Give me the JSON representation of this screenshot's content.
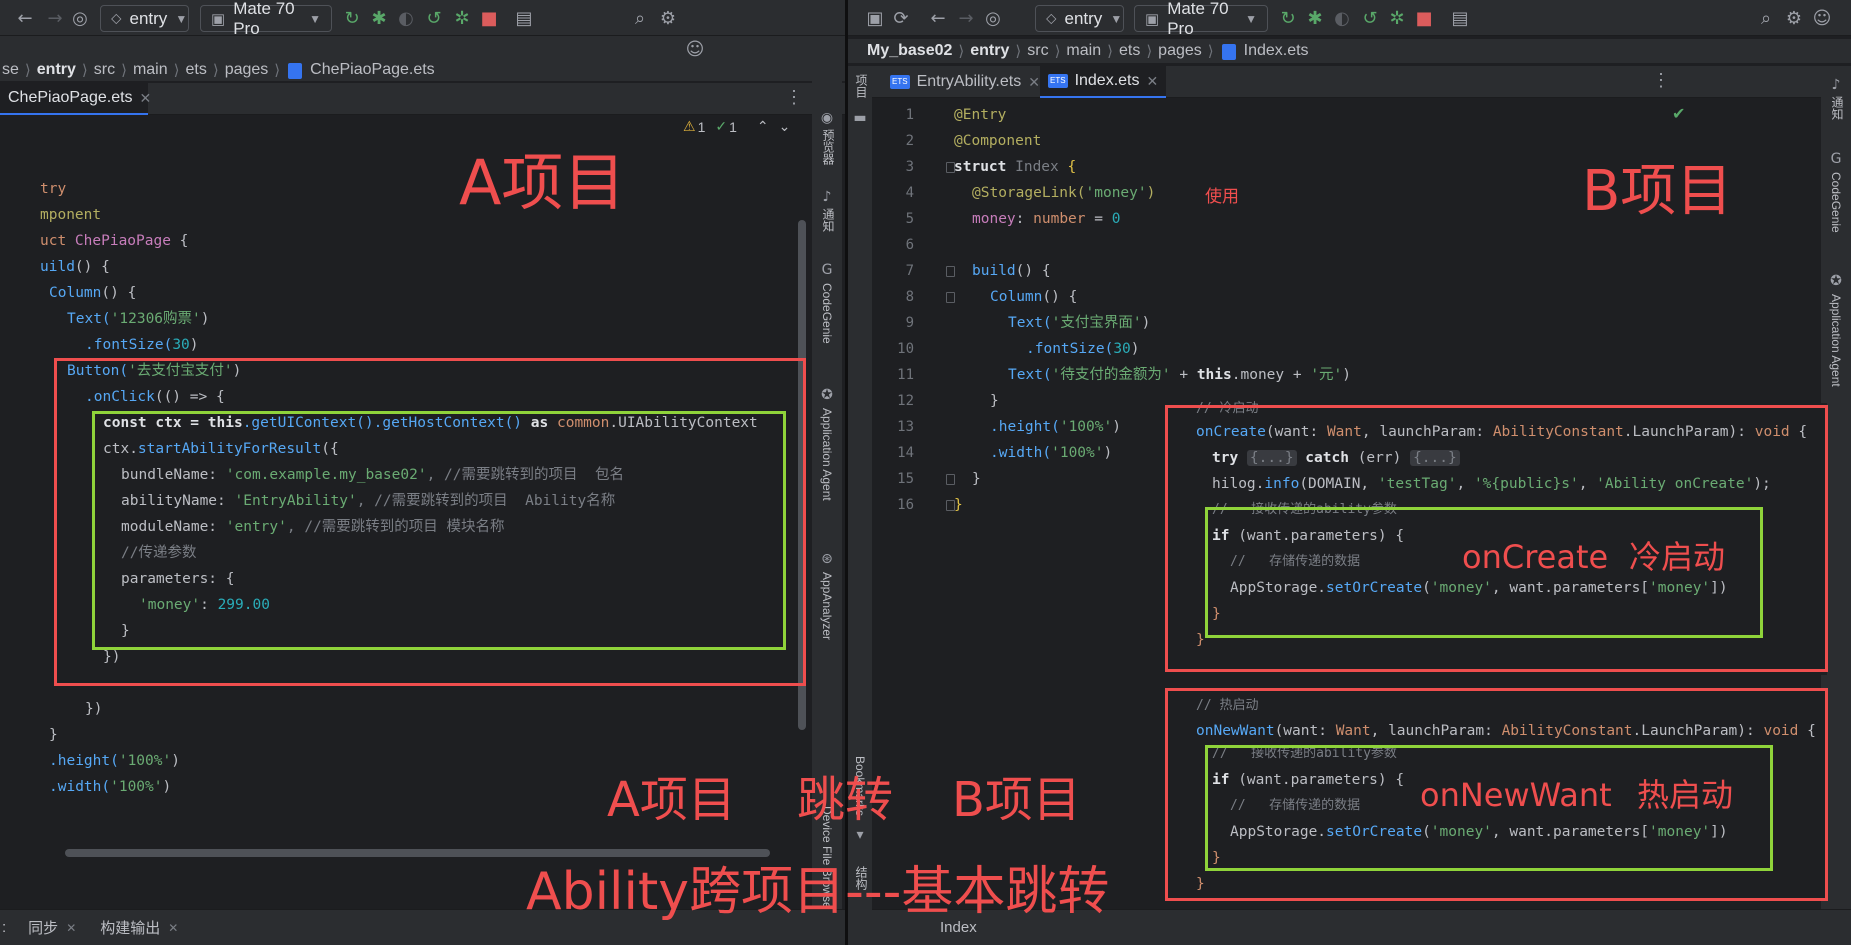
{
  "left": {
    "toolbar": {
      "module": "entry",
      "device": "Mate 70 Pro"
    },
    "breadcrumb": [
      "se",
      "entry",
      "src",
      "main",
      "ets",
      "pages",
      "ChePiaoPage.ets"
    ],
    "tab": "ChePiaoPage.ets",
    "inspections": {
      "warnings": "1",
      "weak": "1"
    },
    "side_labels": [
      "预览器",
      "通知",
      "CodeGenie",
      "Application Agent",
      "AppAnalyzer",
      "Device File Browser"
    ],
    "code_plain": {
      "l1": "try",
      "l2": "mponent",
      "l3_a": "uct ",
      "l3_b": "ChePiaoPage",
      "l3_c": " {",
      "l4_a": "uild",
      "l4_b": "() {",
      "l5_a": "Column",
      "l5_b": "() {",
      "l6_a": "Text(",
      "l6_b": "'12306购票'",
      "l6_c": ")",
      "l7_a": ".fontSize(",
      "l7_b": "30",
      "l7_c": ")",
      "l8_a": "Button(",
      "l8_b": "'去支付宝支付'",
      "l8_c": ")",
      "l9_a": ".onClick",
      "l9_b": "(() => {",
      "l10_a": "const ctx = ",
      "l10_b": "this",
      "l10_c": ".getUIContext().getHostContext() ",
      "l10_d": "as",
      "l10_e": " common",
      "l10_f": ".UIAbilityContext",
      "l11_a": "ctx.",
      "l11_b": "startAbilityForResult",
      "l11_c": "({",
      "l12_a": "bundleName: ",
      "l12_b": "'com.example.my_base02'",
      "l12_c": ", //需要跳转到的项目  包名",
      "l13_a": "abilityName: ",
      "l13_b": "'EntryAbility'",
      "l13_c": ", //需要跳转到的项目  Ability名称",
      "l14_a": "moduleName: ",
      "l14_b": "'entry'",
      "l14_c": ", //需要跳转到的项目 模块名称",
      "l15": "//传递参数",
      "l16": "parameters: {",
      "l17_a": "'money'",
      "l17_b": ": ",
      "l17_c": "299.00",
      "l18": "}",
      "l19": "})",
      "l20": "})",
      "l21": "}",
      "l22_a": ".height(",
      "l22_b": "'100%'",
      "l22_c": ")",
      "l23_a": ".width(",
      "l23_b": "'100%'",
      "l23_c": ")"
    },
    "status_tabs": [
      ":",
      "同步",
      "构建输出"
    ]
  },
  "right": {
    "toolbar": {
      "module": "entry",
      "device": "Mate 70 Pro"
    },
    "breadcrumb": [
      "My_base02",
      "entry",
      "src",
      "main",
      "ets",
      "pages",
      "Index.ets"
    ],
    "tabs": [
      "EntryAbility.ets",
      "Index.ets"
    ],
    "project_label": "项目",
    "side_labels": [
      "通知",
      "CodeGenie",
      "Application Agent"
    ],
    "bottom_labels": [
      "Bookmarks",
      "结构"
    ],
    "status_text": "Index",
    "line_numbers": [
      "1",
      "2",
      "3",
      "4",
      "5",
      "6",
      "7",
      "8",
      "9",
      "10",
      "11",
      "12",
      "13",
      "14",
      "15",
      "16"
    ],
    "code": {
      "l1": "@Entry",
      "l2": "@Component",
      "l3_a": "struct",
      "l3_b": " Index ",
      "l3_c": "{",
      "l4_a": "@StorageLink(",
      "l4_b": "'money'",
      "l4_c": ")",
      "l5_a": "money",
      "l5_b": ": ",
      "l5_c": "number",
      "l5_d": " = ",
      "l5_e": "0",
      "l7_a": "build",
      "l7_b": "() {",
      "l8_a": "Column",
      "l8_b": "() {",
      "l9_a": "Text(",
      "l9_b": "'支付宝界面'",
      "l9_c": ")",
      "l10_a": ".fontSize(",
      "l10_b": "30",
      "l10_c": ")",
      "l11_a": "Text(",
      "l11_b": "'待支付的金额为'",
      "l11_c": " + ",
      "l11_d": "this",
      "l11_e": ".money + ",
      "l11_f": "'元'",
      "l11_g": ")",
      "l12": "}",
      "l13_a": ".height(",
      "l13_b": "'100%'",
      "l13_c": ")",
      "l14_a": ".width(",
      "l14_b": "'100%'",
      "l14_c": ")",
      "l15": "}",
      "l16": "}"
    },
    "overlay1": {
      "comment": "// 冷启动",
      "sig_a": "onCreate",
      "sig_b": "(want: ",
      "sig_c": "Want",
      "sig_d": ", launchParam: ",
      "sig_e": "AbilityConstant",
      "sig_f": ".LaunchParam): ",
      "sig_g": "void",
      "sig_h": " {",
      "try_a": "try ",
      "try_b": "{...}",
      "try_c": " catch ",
      "try_d": "(err) ",
      "try_e": "{...}",
      "hilog_a": "hilog.",
      "hilog_b": "info",
      "hilog_c": "(DOMAIN, ",
      "hilog_d": "'testTag'",
      "hilog_e": ", ",
      "hilog_f": "'%{public}s'",
      "hilog_g": ", ",
      "hilog_h": "'Ability onCreate'",
      "hilog_i": ");",
      "c1": "//   接收传递的ability参数",
      "if_a": "if",
      "if_b": " (want.parameters) {",
      "c2": "//   存储传递的数据",
      "as_a": "AppStorage.",
      "as_b": "setOrCreate",
      "as_c": "(",
      "as_d": "'money'",
      "as_e": ", want.parameters[",
      "as_f": "'money'",
      "as_g": "])",
      "close1": "}",
      "close2": "}"
    },
    "overlay2": {
      "comment": "// 热启动",
      "sig_a": "onNewWant",
      "sig_b": "(want: ",
      "sig_c": "Want",
      "sig_d": ", launchParam: ",
      "sig_e": "AbilityConstant",
      "sig_f": ".LaunchParam): ",
      "sig_g": "void",
      "sig_h": " {",
      "c1": "//   接收传递的ability参数",
      "if_a": "if",
      "if_b": " (want.parameters) {",
      "c2": "//   存储传递的数据",
      "as_a": "AppStorage.",
      "as_b": "setOrCreate",
      "as_c": "(",
      "as_d": "'money'",
      "as_e": ", want.parameters[",
      "as_f": "'money'",
      "as_g": "])",
      "close1": "}",
      "close2": "}"
    }
  },
  "annotations": {
    "a_project": "A项目",
    "b_project": "B项目",
    "use": "使用",
    "bottom_a": "A项目",
    "bottom_jump": "跳转",
    "bottom_b": "B项目",
    "on_create": "onCreate",
    "cold_start": "冷启动",
    "on_new_want": "onNewWant",
    "hot_start": "热启动",
    "title": "Ability跨项目---基本跳转"
  },
  "colors": {
    "annotation": "#ef4e4e",
    "highlight_green": "#8fd33a",
    "accent": "#3574f0"
  }
}
